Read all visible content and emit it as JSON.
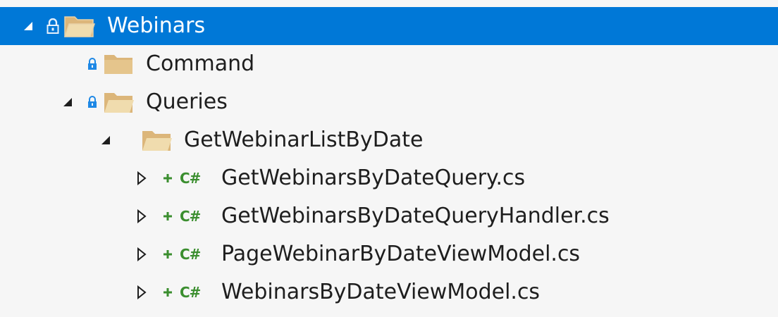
{
  "colors": {
    "selection": "#0078d7",
    "background": "#f6f6f6",
    "folder": "#dcb67a",
    "lock": "#1e88e5",
    "csharp": "#3b8e2f"
  },
  "tree": {
    "root": {
      "label": "Webinars",
      "icon": "folder-open-icon",
      "expanded": true,
      "selected": true
    },
    "command": {
      "label": "Command",
      "icon": "folder-icon"
    },
    "queries": {
      "label": "Queries",
      "icon": "folder-open-icon",
      "expanded": true
    },
    "subfolder": {
      "label": "GetWebinarListByDate",
      "icon": "folder-open-icon",
      "expanded": true
    },
    "files": [
      {
        "label": "GetWebinarsByDateQuery.cs",
        "icon_text": "C#"
      },
      {
        "label": "GetWebinarsByDateQueryHandler.cs",
        "icon_text": "C#"
      },
      {
        "label": "PageWebinarByDateViewModel.cs",
        "icon_text": "C#"
      },
      {
        "label": "WebinarsByDateViewModel.cs",
        "icon_text": "C#"
      }
    ]
  }
}
